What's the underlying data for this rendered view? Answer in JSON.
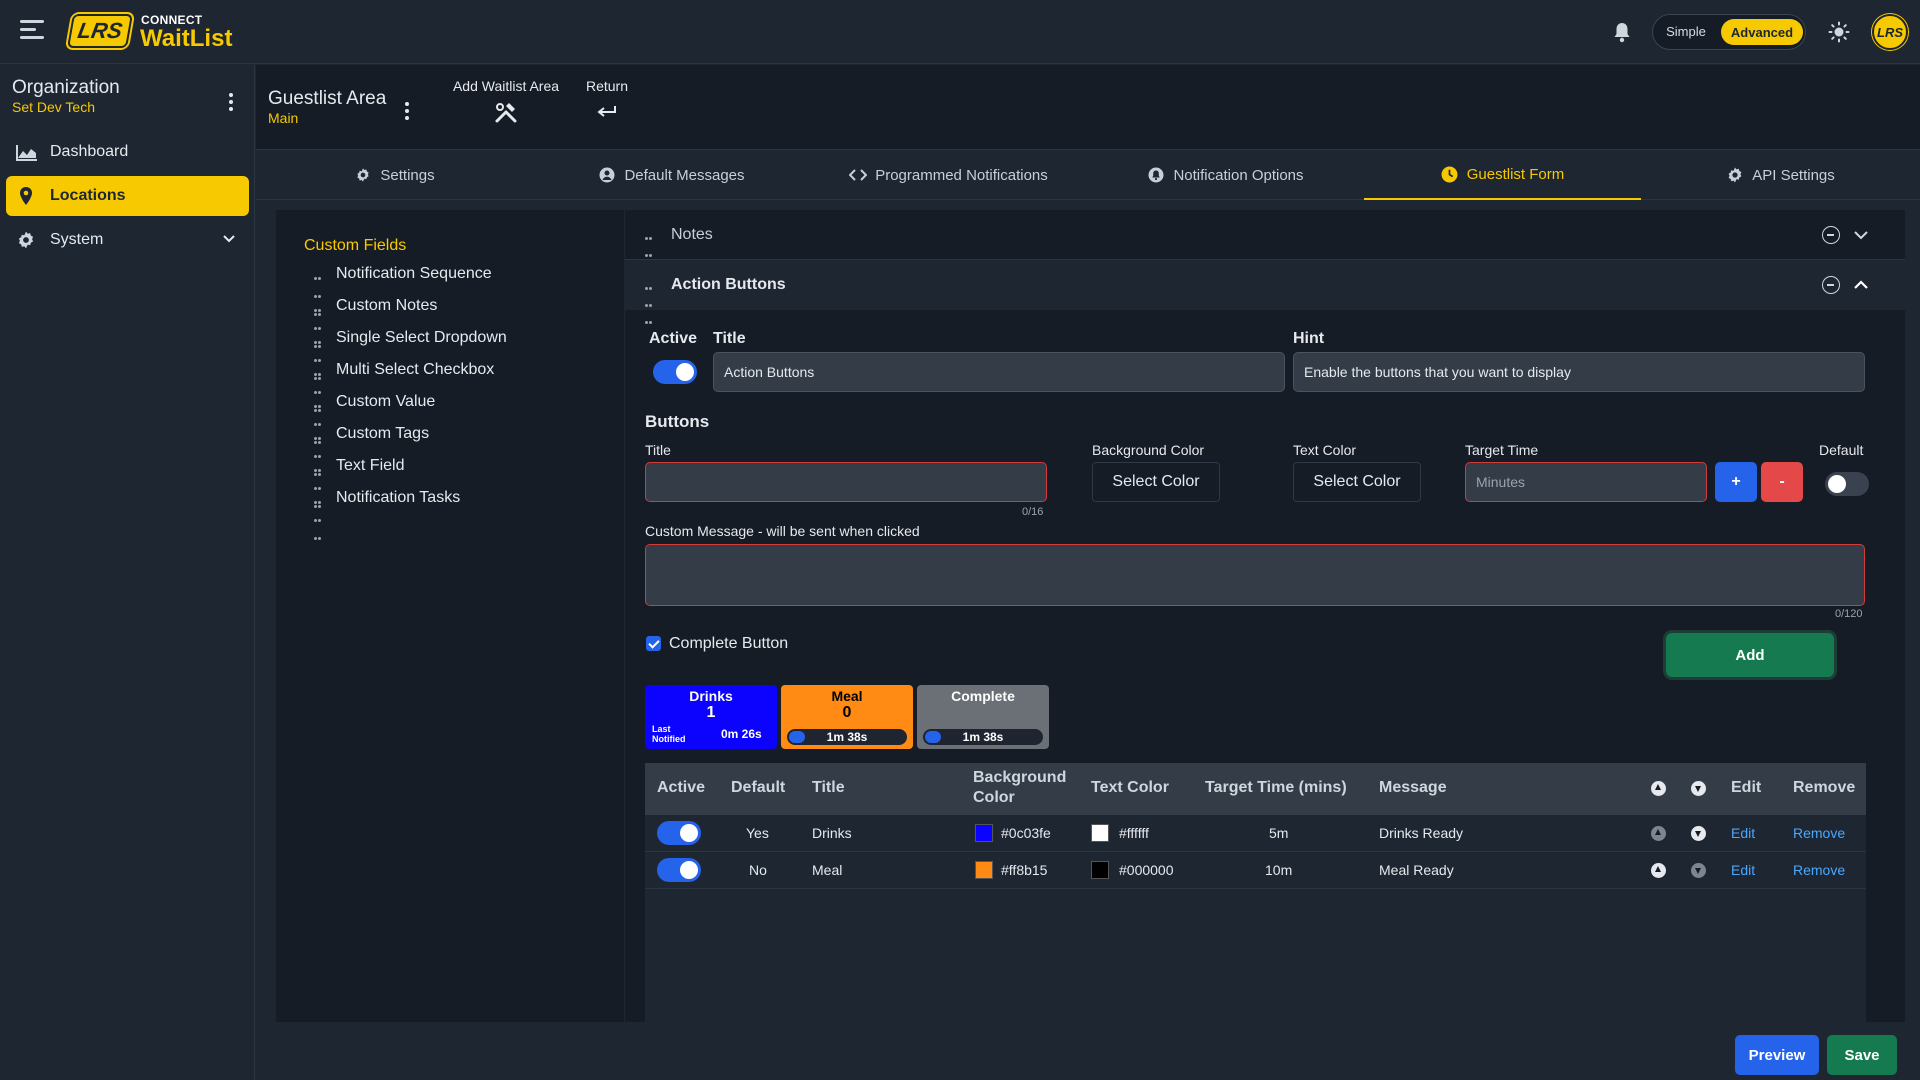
{
  "header": {
    "brand_sub": "CONNECT",
    "brand_main": "WaitList",
    "logo_text": "LRS",
    "mode_simple": "Simple",
    "mode_advanced": "Advanced",
    "avatar_text": "LRS"
  },
  "sidebar": {
    "org_title": "Organization",
    "org_sub": "Set Dev Tech",
    "items": [
      {
        "label": "Dashboard",
        "icon": "chart-icon"
      },
      {
        "label": "Locations",
        "icon": "location-pin-icon"
      },
      {
        "label": "System",
        "icon": "gear-icon"
      }
    ]
  },
  "page_header": {
    "title": "Guestlist Area",
    "sub": "Main",
    "actions": [
      {
        "label": "Add Waitlist Area",
        "icon": "tools-icon"
      },
      {
        "label": "Return",
        "icon": "return-icon"
      }
    ]
  },
  "tabs": [
    {
      "label": "Settings",
      "icon": "gear-icon"
    },
    {
      "label": "Default Messages",
      "icon": "user-circle-icon"
    },
    {
      "label": "Programmed Notifications",
      "icon": "code-icon"
    },
    {
      "label": "Notification Options",
      "icon": "bell-circle-icon"
    },
    {
      "label": "Guestlist Form",
      "icon": "clock-icon"
    },
    {
      "label": "API Settings",
      "icon": "gear-icon"
    }
  ],
  "custom_fields": {
    "title": "Custom Fields",
    "items": [
      "Notification Sequence",
      "Custom Notes",
      "Single Select Dropdown",
      "Multi Select Checkbox",
      "Custom Value",
      "Custom Tags",
      "Text Field",
      "Notification Tasks"
    ]
  },
  "notes_section": {
    "title": "Notes"
  },
  "action_buttons": {
    "title": "Action Buttons",
    "active_label": "Active",
    "title_label": "Title",
    "title_value": "Action Buttons",
    "hint_label": "Hint",
    "hint_value": "Enable the buttons that you want to display",
    "buttons_heading": "Buttons",
    "btn_title_label": "Title",
    "btn_title_counter": "0/16",
    "bg_color_label": "Background Color",
    "bg_color_button": "Select Color",
    "text_color_label": "Text Color",
    "text_color_button": "Select Color",
    "target_time_label": "Target Time",
    "target_time_placeholder": "Minutes",
    "plus": "+",
    "minus": "-",
    "default_label": "Default",
    "custom_message_label": "Custom Message - will be sent when clicked",
    "custom_message_counter": "0/120",
    "complete_button_label": "Complete Button",
    "add_button": "Add"
  },
  "preview_cards": [
    {
      "title": "Drinks",
      "count": "1",
      "last_label": "Last Notified",
      "time": "0m 26s",
      "bg": "#0c03fe",
      "fg": "#ffffff"
    },
    {
      "title": "Meal",
      "count": "0",
      "time": "1m 38s",
      "bg": "#ff8b15",
      "fg": "#000000"
    },
    {
      "title": "Complete",
      "time": "1m 38s",
      "bg": "#6b6f76",
      "fg": "#ffffff"
    }
  ],
  "table": {
    "headers": {
      "active": "Active",
      "default": "Default",
      "title": "Title",
      "bg_line1": "Background",
      "bg_line2": "Color",
      "text_color": "Text Color",
      "target": "Target Time (mins)",
      "message": "Message",
      "edit": "Edit",
      "remove": "Remove"
    },
    "rows": [
      {
        "default": "Yes",
        "title": "Drinks",
        "bg": "#0c03fe",
        "text": "#ffffff",
        "target": "5m",
        "message": "Drinks Ready",
        "edit": "Edit",
        "remove": "Remove"
      },
      {
        "default": "No",
        "title": "Meal",
        "bg": "#ff8b15",
        "text": "#000000",
        "target": "10m",
        "message": "Meal Ready",
        "edit": "Edit",
        "remove": "Remove"
      }
    ]
  },
  "footer": {
    "preview": "Preview",
    "save": "Save"
  },
  "colors": {
    "accent": "#f7c900",
    "primary": "#2563eb",
    "success": "#157a4f",
    "danger": "#e54848"
  }
}
